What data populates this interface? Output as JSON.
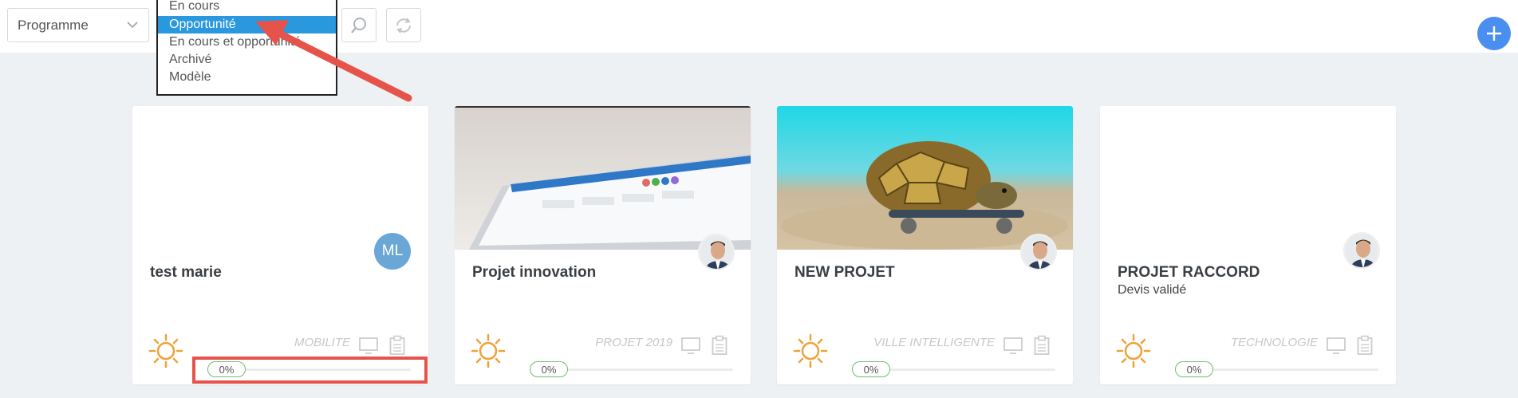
{
  "toolbar": {
    "program_select": {
      "value": "Programme"
    },
    "icons": {
      "select_chevron": "chevron-down-icon",
      "search": "search-icon",
      "refresh": "refresh-icon",
      "add": "plus-icon"
    },
    "accent_color": "#4a8ff0"
  },
  "status_dropdown": {
    "options": [
      {
        "label": "En cours",
        "selected": false
      },
      {
        "label": "Opportunité",
        "selected": true
      },
      {
        "label": "En cours et opportunité",
        "selected": false
      },
      {
        "label": "Archivé",
        "selected": false
      },
      {
        "label": "Modèle",
        "selected": false
      }
    ],
    "selected_color": "#2a98de"
  },
  "annotation_colors": {
    "arrow": "#e5534b",
    "highlight_box": "#e5534b"
  },
  "cards": [
    {
      "title": "test marie",
      "subtitle": "",
      "avatar_initials": "ML",
      "tag": "MOBILITE",
      "progress_label": "0%",
      "progress": 0,
      "image": "none",
      "weather_icon": "sun-icon"
    },
    {
      "title": "Projet innovation",
      "subtitle": "",
      "avatar_initials": "",
      "tag": "PROJET 2019",
      "progress_label": "0%",
      "progress": 0,
      "image": "laptop-photo",
      "weather_icon": "sun-icon"
    },
    {
      "title": "NEW PROJET",
      "subtitle": "",
      "avatar_initials": "",
      "tag": "VILLE INTELLIGENTE",
      "progress_label": "0%",
      "progress": 0,
      "image": "turtle-skateboard-photo",
      "weather_icon": "sun-icon"
    },
    {
      "title": "PROJET RACCORD",
      "subtitle": "Devis validé",
      "avatar_initials": "",
      "tag": "TECHNOLOGIE",
      "progress_label": "0%",
      "progress": 0,
      "image": "none",
      "weather_icon": "sun-icon"
    }
  ],
  "colors": {
    "sun": "#f0a23a",
    "progress": "#5cb85c",
    "background": "#eef1f3"
  }
}
